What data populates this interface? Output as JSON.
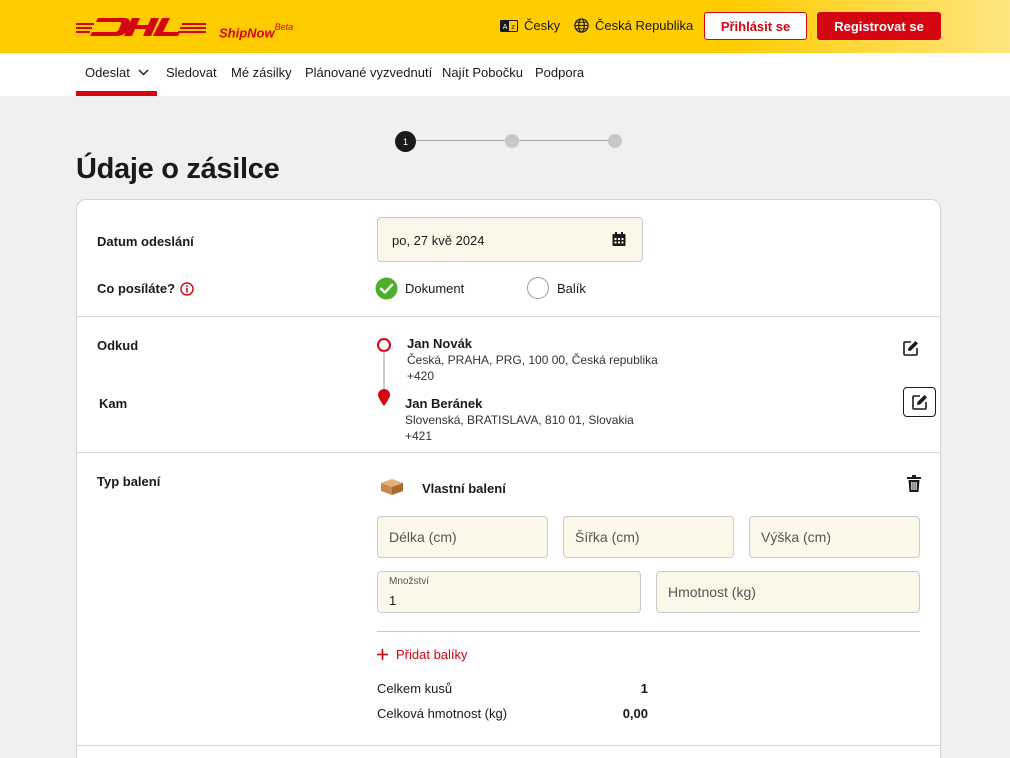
{
  "header": {
    "brand_suffix": "ShipNow",
    "brand_beta": "Beta",
    "language": "Česky",
    "country": "Česká Republika",
    "login_label": "Přihlásit se",
    "register_label": "Registrovat se",
    "brand_color": "#d40511",
    "accent_color": "#ffcc00"
  },
  "nav": {
    "items": [
      {
        "label": "Odeslat"
      },
      {
        "label": "Sledovat"
      },
      {
        "label": "Mé zásilky"
      },
      {
        "label": "Plánované vyzvednutí"
      },
      {
        "label": "Najít Pobočku"
      },
      {
        "label": "Podpora"
      }
    ]
  },
  "stepper": {
    "current_step": "1"
  },
  "page": {
    "title": "Údaje o zásilce"
  },
  "form": {
    "date_label": "Datum odeslání",
    "date_value": "po, 27 kvě 2024",
    "what_label": "Co posíláte?",
    "option_document": "Dokument",
    "option_package": "Balík",
    "selected_option": "Dokument",
    "from_label": "Odkud",
    "to_label": "Kam",
    "sender": {
      "name": "Jan Novák",
      "address": "Česká, PRAHA, PRG, 100 00, Česká republika",
      "phone": "+420"
    },
    "recipient": {
      "name": "Jan Beránek",
      "address": "Slovenská, BRATISLAVA, 810 01, Slovakia",
      "phone": "+421"
    },
    "packaging_label": "Typ balení",
    "packaging_value": "Vlastní balení",
    "length_placeholder": "Délka (cm)",
    "width_placeholder": "Šířka (cm)",
    "height_placeholder": "Výška (cm)",
    "quantity_label": "Množství",
    "quantity_value": "1",
    "weight_placeholder": "Hmotnost (kg)",
    "add_packages": "Přidat balíky",
    "total_pieces_label": "Celkem kusů",
    "total_pieces_value": "1",
    "total_weight_label": "Celková hmotnost (kg)",
    "total_weight_value": "0,00"
  }
}
